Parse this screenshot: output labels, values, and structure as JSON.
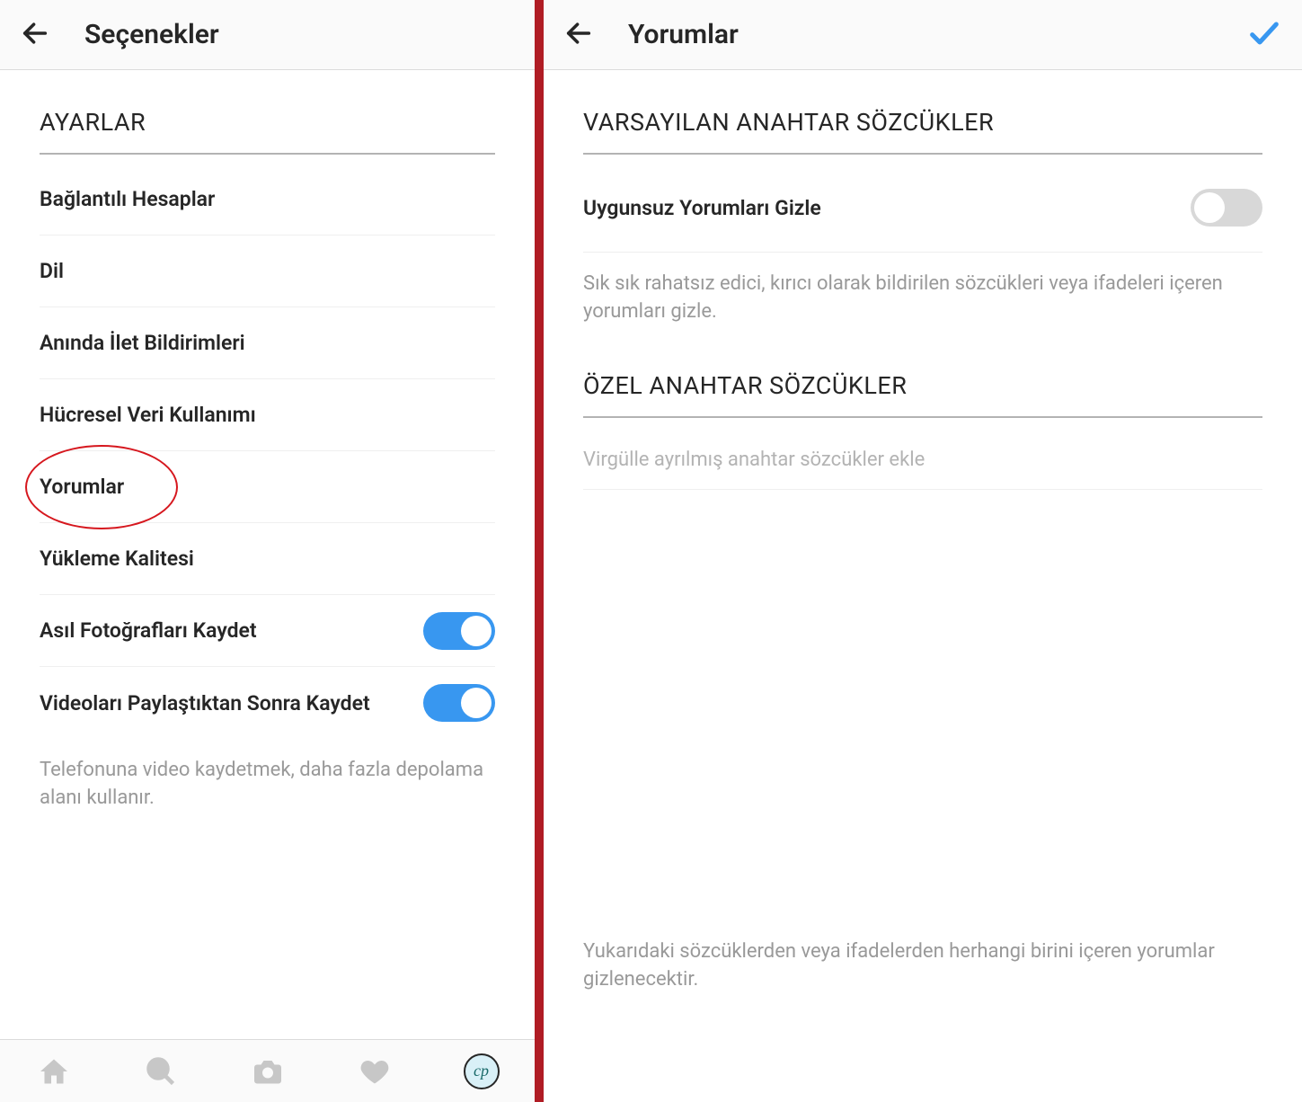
{
  "left": {
    "header_title": "Seçenekler",
    "section_title": "AYARLAR",
    "items": [
      {
        "label": "Bağlantılı Hesaplar"
      },
      {
        "label": "Dil"
      },
      {
        "label": "Anında İlet Bildirimleri"
      },
      {
        "label": "Hücresel Veri Kullanımı"
      },
      {
        "label": "Yorumlar"
      },
      {
        "label": "Yükleme Kalitesi"
      }
    ],
    "toggle_items": [
      {
        "label": "Asıl Fotoğrafları Kaydet"
      },
      {
        "label": "Videoları Paylaştıktan Sonra Kaydet"
      }
    ],
    "footer_desc": "Telefonuna video kaydetmek, daha fazla depolama alanı kullanır.",
    "profile_initials": "cp"
  },
  "right": {
    "header_title": "Yorumlar",
    "section1_title": "VARSAYILAN ANAHTAR SÖZCÜKLER",
    "hide_label": "Uygunsuz Yorumları Gizle",
    "hide_desc": "Sık sık rahatsız edici, kırıcı olarak bildirilen sözcükleri veya ifadeleri içeren yorumları gizle.",
    "section2_title": "ÖZEL ANAHTAR SÖZCÜKLER",
    "input_placeholder": "Virgülle ayrılmış anahtar sözcükler ekle",
    "bottom_desc": "Yukarıdaki sözcüklerden veya ifadelerden herhangi birini içeren yorumlar gizlenecektir."
  }
}
